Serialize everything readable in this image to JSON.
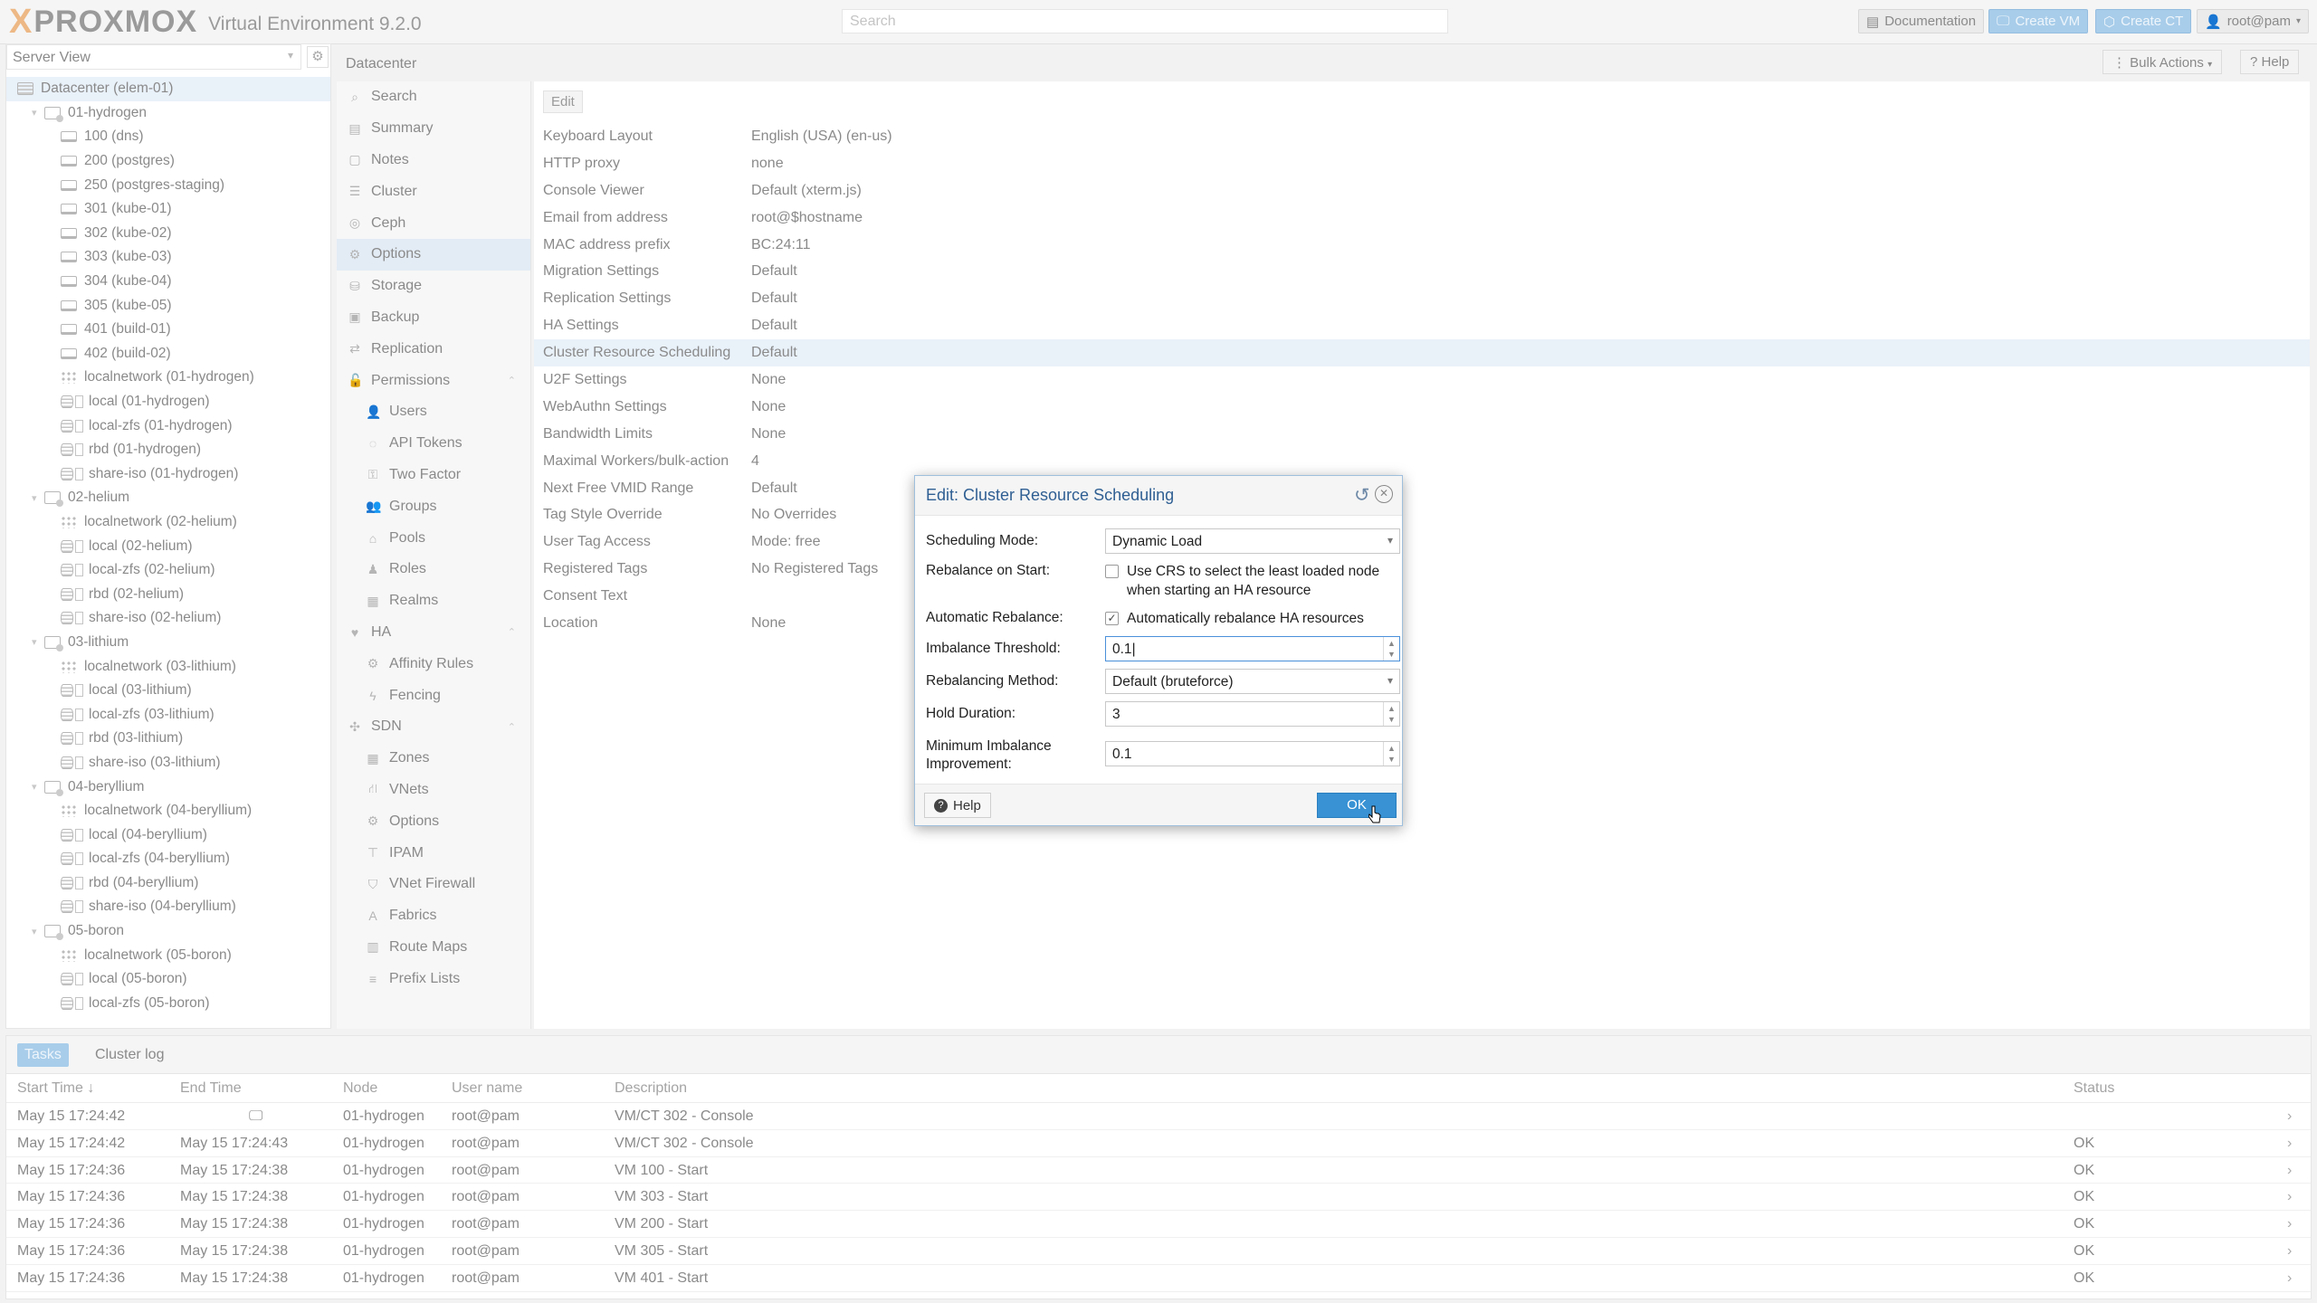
{
  "topbar": {
    "logo_x": "X",
    "logo_text": "PROXMOX",
    "version": "Virtual Environment 9.2.0",
    "search_placeholder": "Search",
    "documentation": "Documentation",
    "create_vm": "Create VM",
    "create_ct": "Create CT",
    "user": "root@pam"
  },
  "tree": {
    "view": "Server View",
    "items": [
      {
        "label": "Datacenter (elem-01)",
        "type": "dc"
      },
      {
        "label": "01-hydrogen",
        "type": "node"
      },
      {
        "label": "100 (dns)",
        "type": "vm"
      },
      {
        "label": "200 (postgres)",
        "type": "vm"
      },
      {
        "label": "250 (postgres-staging)",
        "type": "vm"
      },
      {
        "label": "301 (kube-01)",
        "type": "vm"
      },
      {
        "label": "302 (kube-02)",
        "type": "vm"
      },
      {
        "label": "303 (kube-03)",
        "type": "vm"
      },
      {
        "label": "304 (kube-04)",
        "type": "vm"
      },
      {
        "label": "305 (kube-05)",
        "type": "vm"
      },
      {
        "label": "401 (build-01)",
        "type": "vm"
      },
      {
        "label": "402 (build-02)",
        "type": "vm"
      },
      {
        "label": "localnetwork (01-hydrogen)",
        "type": "net"
      },
      {
        "label": "local (01-hydrogen)",
        "type": "stor"
      },
      {
        "label": "local-zfs (01-hydrogen)",
        "type": "stor"
      },
      {
        "label": "rbd (01-hydrogen)",
        "type": "stor"
      },
      {
        "label": "share-iso (01-hydrogen)",
        "type": "stor"
      },
      {
        "label": "02-helium",
        "type": "node"
      },
      {
        "label": "localnetwork (02-helium)",
        "type": "net"
      },
      {
        "label": "local (02-helium)",
        "type": "stor"
      },
      {
        "label": "local-zfs (02-helium)",
        "type": "stor"
      },
      {
        "label": "rbd (02-helium)",
        "type": "stor"
      },
      {
        "label": "share-iso (02-helium)",
        "type": "stor"
      },
      {
        "label": "03-lithium",
        "type": "node"
      },
      {
        "label": "localnetwork (03-lithium)",
        "type": "net"
      },
      {
        "label": "local (03-lithium)",
        "type": "stor"
      },
      {
        "label": "local-zfs (03-lithium)",
        "type": "stor"
      },
      {
        "label": "rbd (03-lithium)",
        "type": "stor"
      },
      {
        "label": "share-iso (03-lithium)",
        "type": "stor"
      },
      {
        "label": "04-beryllium",
        "type": "node"
      },
      {
        "label": "localnetwork (04-beryllium)",
        "type": "net"
      },
      {
        "label": "local (04-beryllium)",
        "type": "stor"
      },
      {
        "label": "local-zfs (04-beryllium)",
        "type": "stor"
      },
      {
        "label": "rbd (04-beryllium)",
        "type": "stor"
      },
      {
        "label": "share-iso (04-beryllium)",
        "type": "stor"
      },
      {
        "label": "05-boron",
        "type": "node"
      },
      {
        "label": "localnetwork (05-boron)",
        "type": "net"
      },
      {
        "label": "local (05-boron)",
        "type": "stor"
      },
      {
        "label": "local-zfs (05-boron)",
        "type": "stor"
      }
    ]
  },
  "content": {
    "breadcrumb": "Datacenter",
    "bulk_actions": "Bulk Actions",
    "help": "Help"
  },
  "nav": [
    {
      "label": "Search",
      "icon": "search-icon",
      "glyph": "⌕"
    },
    {
      "label": "Summary",
      "icon": "book-icon",
      "glyph": "▤"
    },
    {
      "label": "Notes",
      "icon": "notes-icon",
      "glyph": "▢"
    },
    {
      "label": "Cluster",
      "icon": "server-icon",
      "glyph": "☰"
    },
    {
      "label": "Ceph",
      "icon": "ceph-icon",
      "glyph": "◎"
    },
    {
      "label": "Options",
      "icon": "gear-icon",
      "glyph": "⚙"
    },
    {
      "label": "Storage",
      "icon": "database-icon",
      "glyph": "⛁"
    },
    {
      "label": "Backup",
      "icon": "floppy-icon",
      "glyph": "▣"
    },
    {
      "label": "Replication",
      "icon": "retweet-icon",
      "glyph": "⇄"
    },
    {
      "label": "Permissions",
      "icon": "unlock-icon",
      "glyph": "🔓"
    },
    {
      "label": "Users",
      "icon": "user-icon",
      "glyph": "👤"
    },
    {
      "label": "API Tokens",
      "icon": "user-outline-icon",
      "glyph": "◌"
    },
    {
      "label": "Two Factor",
      "icon": "key-icon",
      "glyph": "⚿"
    },
    {
      "label": "Groups",
      "icon": "users-icon",
      "glyph": "👥"
    },
    {
      "label": "Pools",
      "icon": "tags-icon",
      "glyph": "⌂"
    },
    {
      "label": "Roles",
      "icon": "male-icon",
      "glyph": "♟"
    },
    {
      "label": "Realms",
      "icon": "address-book-icon",
      "glyph": "▦"
    },
    {
      "label": "HA",
      "icon": "heartbeat-icon",
      "glyph": "♥"
    },
    {
      "label": "Affinity Rules",
      "icon": "cogs-icon",
      "glyph": "⚙"
    },
    {
      "label": "Fencing",
      "icon": "bolt-icon",
      "glyph": "ϟ"
    },
    {
      "label": "SDN",
      "icon": "sdn-icon",
      "glyph": "✣"
    },
    {
      "label": "Zones",
      "icon": "th-icon",
      "glyph": "▦"
    },
    {
      "label": "VNets",
      "icon": "network-icon",
      "glyph": "⛙"
    },
    {
      "label": "Options",
      "icon": "gear-icon",
      "glyph": "⚙"
    },
    {
      "label": "IPAM",
      "icon": "ipam-icon",
      "glyph": "⊤"
    },
    {
      "label": "VNet Firewall",
      "icon": "shield-icon",
      "glyph": "⛉"
    },
    {
      "label": "Fabrics",
      "icon": "font-icon",
      "glyph": "A"
    },
    {
      "label": "Route Maps",
      "icon": "map-icon",
      "glyph": "▥"
    },
    {
      "label": "Prefix Lists",
      "icon": "list-icon",
      "glyph": "≡"
    }
  ],
  "options_panel": {
    "edit": "Edit",
    "rows": [
      {
        "key": "Keyboard Layout",
        "value": "English (USA) (en-us)"
      },
      {
        "key": "HTTP proxy",
        "value": "none"
      },
      {
        "key": "Console Viewer",
        "value": "Default (xterm.js)"
      },
      {
        "key": "Email from address",
        "value": "root@$hostname"
      },
      {
        "key": "MAC address prefix",
        "value": "BC:24:11"
      },
      {
        "key": "Migration Settings",
        "value": "Default"
      },
      {
        "key": "Replication Settings",
        "value": "Default"
      },
      {
        "key": "HA Settings",
        "value": "Default"
      },
      {
        "key": "Cluster Resource Scheduling",
        "value": "Default"
      },
      {
        "key": "U2F Settings",
        "value": "None"
      },
      {
        "key": "WebAuthn Settings",
        "value": "None"
      },
      {
        "key": "Bandwidth Limits",
        "value": "None"
      },
      {
        "key": "Maximal Workers/bulk-action",
        "value": "4"
      },
      {
        "key": "Next Free VMID Range",
        "value": "Default"
      },
      {
        "key": "Tag Style Override",
        "value": "No Overrides"
      },
      {
        "key": "User Tag Access",
        "value": "Mode: free"
      },
      {
        "key": "Registered Tags",
        "value": "No Registered Tags"
      },
      {
        "key": "Consent Text",
        "value": ""
      },
      {
        "key": "Location",
        "value": "None"
      }
    ]
  },
  "tasks": {
    "tab_tasks": "Tasks",
    "tab_cluster_log": "Cluster log",
    "headers": {
      "start": "Start Time ↓",
      "end": "End Time",
      "node": "Node",
      "user": "User name",
      "desc": "Description",
      "status": "Status"
    },
    "rows": [
      {
        "start": "May 15 17:24:42",
        "end": "🖵",
        "node": "01-hydrogen",
        "user": "root@pam",
        "desc": "VM/CT 302 - Console",
        "status": ""
      },
      {
        "start": "May 15 17:24:42",
        "end": "May 15 17:24:43",
        "node": "01-hydrogen",
        "user": "root@pam",
        "desc": "VM/CT 302 - Console",
        "status": "OK"
      },
      {
        "start": "May 15 17:24:36",
        "end": "May 15 17:24:38",
        "node": "01-hydrogen",
        "user": "root@pam",
        "desc": "VM 100 - Start",
        "status": "OK"
      },
      {
        "start": "May 15 17:24:36",
        "end": "May 15 17:24:38",
        "node": "01-hydrogen",
        "user": "root@pam",
        "desc": "VM 303 - Start",
        "status": "OK"
      },
      {
        "start": "May 15 17:24:36",
        "end": "May 15 17:24:38",
        "node": "01-hydrogen",
        "user": "root@pam",
        "desc": "VM 200 - Start",
        "status": "OK"
      },
      {
        "start": "May 15 17:24:36",
        "end": "May 15 17:24:38",
        "node": "01-hydrogen",
        "user": "root@pam",
        "desc": "VM 305 - Start",
        "status": "OK"
      },
      {
        "start": "May 15 17:24:36",
        "end": "May 15 17:24:38",
        "node": "01-hydrogen",
        "user": "root@pam",
        "desc": "VM 401 - Start",
        "status": "OK"
      }
    ]
  },
  "dialog": {
    "title": "Edit: Cluster Resource Scheduling",
    "scheduling_mode_label": "Scheduling Mode:",
    "scheduling_mode_value": "Dynamic Load",
    "rebalance_on_start_label": "Rebalance on Start:",
    "rebalance_on_start_text": "Use CRS to select the least loaded node when starting an HA resource",
    "rebalance_on_start_checked": false,
    "auto_rebalance_label": "Automatic Rebalance:",
    "auto_rebalance_text": "Automatically rebalance HA resources",
    "auto_rebalance_checked": true,
    "imbalance_threshold_label": "Imbalance Threshold:",
    "imbalance_threshold_value": "0.1",
    "rebalancing_method_label": "Rebalancing Method:",
    "rebalancing_method_value": "Default (bruteforce)",
    "hold_duration_label": "Hold Duration:",
    "hold_duration_value": "3",
    "min_improvement_label": "Minimum Imbalance Improvement:",
    "min_improvement_value": "0.1",
    "help": "Help",
    "ok": "OK"
  },
  "colors": {
    "accent": "#3892d4",
    "title": "#2f5f93",
    "selection": "#e9f1f9"
  }
}
